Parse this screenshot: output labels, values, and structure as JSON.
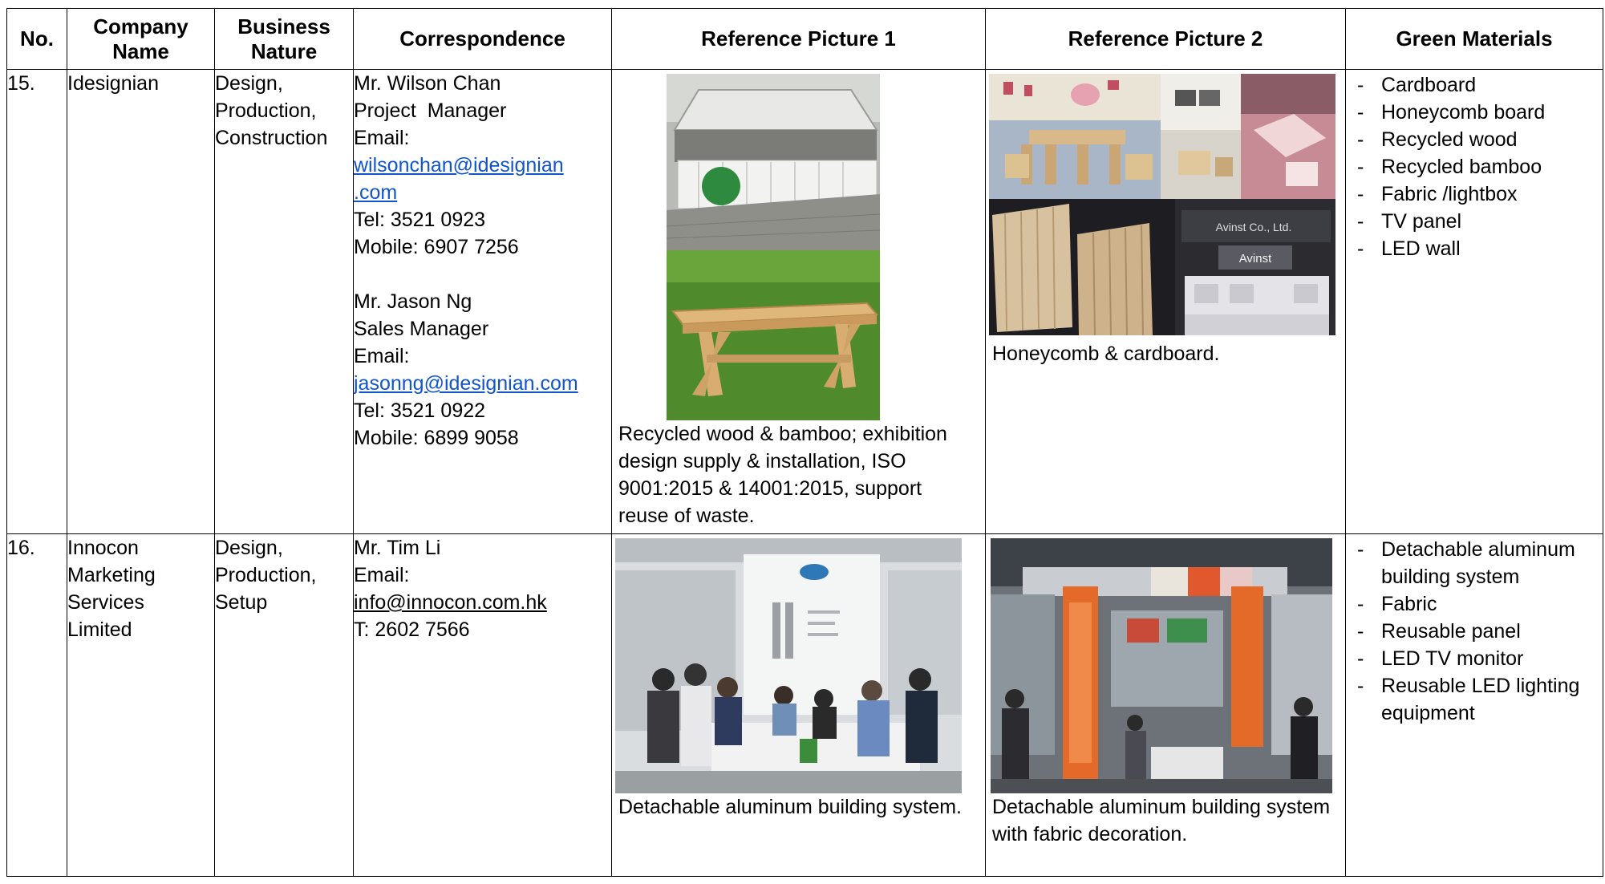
{
  "headers": {
    "no": "No.",
    "company": "Company Name",
    "business": "Business Nature",
    "correspondence": "Correspondence",
    "pic1": "Reference Picture 1",
    "pic2": "Reference Picture 2",
    "green": "Green Materials"
  },
  "rows": [
    {
      "no": "15.",
      "company": "Idesignian",
      "business": [
        "Design,",
        "Production,",
        "Construction"
      ],
      "contacts": [
        {
          "name": "Mr. Wilson Chan",
          "title": "Project  Manager",
          "email_label": "Email:",
          "email_lines": [
            "wilsonchan@idesignian",
            ".com"
          ],
          "tel": "Tel: 3521 0923",
          "mobile": "Mobile: 6907 7256"
        },
        {
          "name": "Mr. Jason Ng",
          "title": "Sales Manager",
          "email_label": "Email:",
          "email_lines": [
            "jasonng@idesignian.com"
          ],
          "tel": "Tel: 3521 0922",
          "mobile": "Mobile: 6899 9058"
        }
      ],
      "pic1_caption": [
        "Recycled wood & bamboo; exhibition",
        "design supply & installation, ISO",
        "9001:2015 & 14001:2015, support",
        "reuse of waste."
      ],
      "pic2_caption": [
        "Honeycomb & cardboard."
      ],
      "pic2_sign1": "Avinst Co., Ltd.",
      "pic2_sign2": "Avinst",
      "materials": [
        "Cardboard",
        "Honeycomb board",
        "Recycled wood",
        "Recycled bamboo",
        "Fabric /lightbox",
        "TV panel",
        "LED wall"
      ]
    },
    {
      "no": "16.",
      "company": [
        "Innocon",
        "Marketing",
        "Services",
        "Limited"
      ],
      "business": [
        "Design,",
        "Production,",
        "Setup"
      ],
      "contact": {
        "name": "Mr. Tim Li",
        "email_label": "Email:",
        "email": "info@innocon.com.hk",
        "tel": "T: 2602 7566"
      },
      "pic1_caption": [
        "Detachable aluminum building system."
      ],
      "pic2_caption": [
        "Detachable aluminum building system",
        "with fabric decoration."
      ],
      "materials": [
        "Detachable aluminum building system",
        "Fabric",
        "Reusable panel",
        "LED TV monitor",
        "Reusable LED lighting equipment"
      ]
    }
  ]
}
